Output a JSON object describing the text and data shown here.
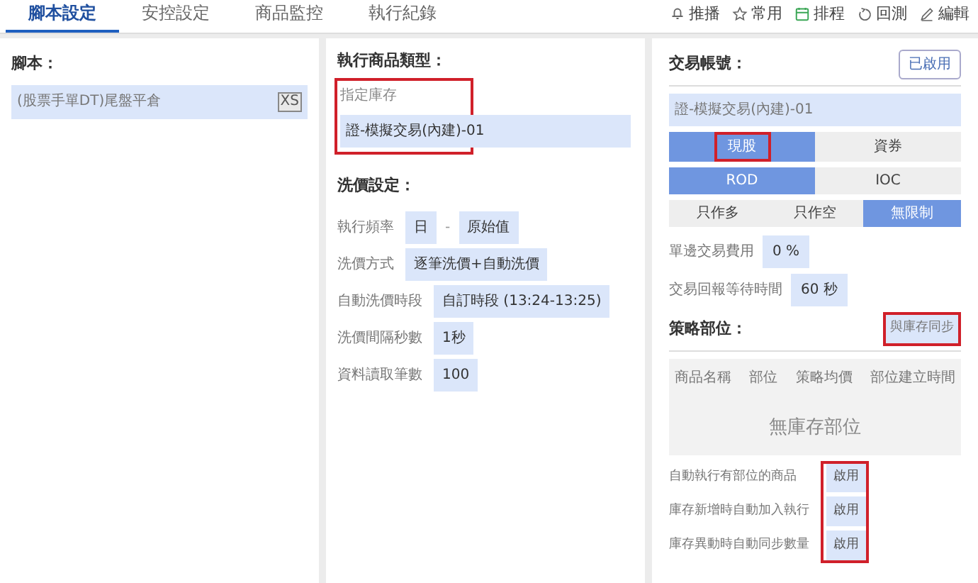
{
  "tabs": [
    {
      "label": "腳本設定",
      "selected": true
    },
    {
      "label": "安控設定",
      "selected": false
    },
    {
      "label": "商品監控",
      "selected": false
    },
    {
      "label": "執行紀錄",
      "selected": false
    }
  ],
  "toolbar": [
    {
      "kind": "bell",
      "label": "推播"
    },
    {
      "kind": "star",
      "label": "常用"
    },
    {
      "kind": "calendar",
      "label": "排程"
    },
    {
      "kind": "replay",
      "label": "回測"
    },
    {
      "kind": "pen",
      "label": "編輯"
    }
  ],
  "script_panel": {
    "title": "腳本：",
    "script": "(股票手單DT)尾盤平倉",
    "badge": "XS"
  },
  "product_panel": {
    "title": "執行商品類型：",
    "inventory": {
      "label": "指定庫存",
      "value": "證-模擬交易(內建)-01",
      "highlighted": true
    },
    "pricing_title": "洗價設定：",
    "settings": [
      {
        "label": "執行頻率",
        "values": [
          "日",
          "原始值"
        ],
        "separator": "-"
      },
      {
        "label": "洗價方式",
        "values": [
          "逐筆洗價+自動洗價"
        ]
      },
      {
        "label": "自動洗價時段",
        "values": [
          "自訂時段 (13:24-13:25)"
        ]
      },
      {
        "label": "洗價間隔秒數",
        "values": [
          "1秒"
        ]
      },
      {
        "label": "資料讀取筆數",
        "values": [
          "100"
        ]
      }
    ]
  },
  "account_panel": {
    "title": "交易帳號：",
    "status_button": "已啟用",
    "account": "證-模擬交易(內建)-01",
    "segments": [
      [
        {
          "label": "現股",
          "selected": true,
          "highlighted": true
        },
        {
          "label": "資券",
          "selected": false,
          "highlighted": false
        }
      ],
      [
        {
          "label": "ROD",
          "selected": true,
          "highlighted": false
        },
        {
          "label": "IOC",
          "selected": false,
          "highlighted": false
        }
      ],
      [
        {
          "label": "只作多",
          "selected": false,
          "highlighted": false
        },
        {
          "label": "只作空",
          "selected": false,
          "highlighted": false
        },
        {
          "label": "無限制",
          "selected": true,
          "highlighted": false
        }
      ]
    ],
    "fields": [
      {
        "label": "單邊交易費用",
        "value": "0 %"
      },
      {
        "label": "交易回報等待時間",
        "value": "60 秒"
      }
    ],
    "positions": {
      "title": "策略部位：",
      "sync_button": {
        "label": "與庫存同步",
        "highlighted": true
      },
      "columns": [
        "商品名稱",
        "部位",
        "策略均價",
        "部位建立時間"
      ],
      "empty": "無庫存部位"
    },
    "auto_options_highlighted": true,
    "auto_options": [
      {
        "label": "自動執行有部位的商品",
        "value": "啟用"
      },
      {
        "label": "庫存新增時自動加入執行",
        "value": "啟用"
      },
      {
        "label": "庫存異動時自動同步數量",
        "value": "啟用"
      }
    ]
  }
}
